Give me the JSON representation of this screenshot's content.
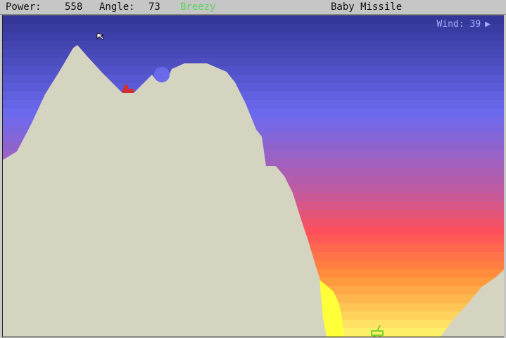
{
  "hud": {
    "power_label": "Power:",
    "power_value": "558",
    "angle_label": "Angle:",
    "angle_value": "73",
    "player_name": "Breezy",
    "player_color": "#5cd65c",
    "weapon_icon": "missile-icon",
    "weapon_name": "Baby Missile"
  },
  "wind": {
    "label": "Wind:",
    "value": "39",
    "direction": "right"
  },
  "colors": {
    "terrain": "#d4d4c0",
    "tank_player": "#d03030",
    "tank_enemy": "#7fd030",
    "hud_background": "#c6c6c6"
  },
  "icons": [
    "mouse-cursor-icon",
    "missile-icon",
    "wind-arrow-icon"
  ]
}
